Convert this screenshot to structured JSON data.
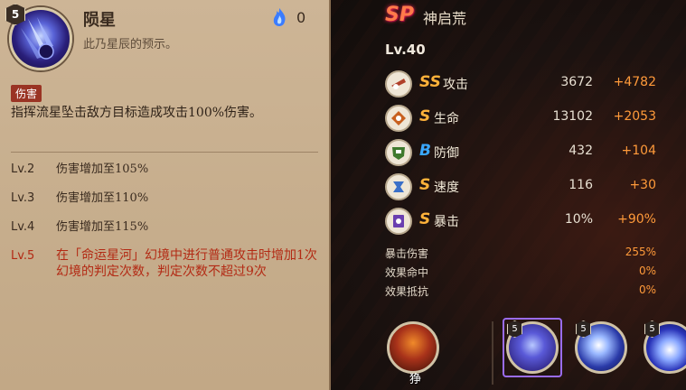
{
  "left": {
    "skill_level": "5",
    "skill_name": "陨星",
    "skill_desc": "此乃星辰的预示。",
    "orb_cost": "0",
    "tag": "伤害",
    "main_text": "指挥流星坠击敌方目标造成攻击100%伤害。",
    "levels": [
      {
        "lv": "Lv.2",
        "text": "伤害增加至105%"
      },
      {
        "lv": "Lv.3",
        "text": "伤害增加至110%"
      },
      {
        "lv": "Lv.4",
        "text": "伤害增加至115%"
      },
      {
        "lv": "Lv.5",
        "text": "在「命运星河」幻境中进行普通攻击时增加1次幻境的判定次数，判定次数不超过9次"
      }
    ]
  },
  "right": {
    "rarity": "SP",
    "name": "神启荒",
    "level": "Lv.40",
    "stats": [
      {
        "grade": "SS",
        "label": "攻击",
        "value": "3672",
        "bonus": "+4782",
        "grade_color": "#ffb23a",
        "icon": "attack-icon"
      },
      {
        "grade": "S",
        "label": "生命",
        "value": "13102",
        "bonus": "+2053",
        "grade_color": "#ffb23a",
        "icon": "hp-icon"
      },
      {
        "grade": "B",
        "label": "防御",
        "value": "432",
        "bonus": "+104",
        "grade_color": "#3aa8ff",
        "icon": "defense-icon"
      },
      {
        "grade": "S",
        "label": "速度",
        "value": "116",
        "bonus": "+30",
        "grade_color": "#ffb23a",
        "icon": "speed-icon"
      },
      {
        "grade": "S",
        "label": "暴击",
        "value": "10%",
        "bonus": "+90%",
        "grade_color": "#ffb23a",
        "icon": "crit-icon"
      }
    ],
    "sub_stats": [
      {
        "label": "暴击伤害",
        "value": "255%"
      },
      {
        "label": "效果命中",
        "value": "0%"
      },
      {
        "label": "效果抵抗",
        "value": "0%"
      }
    ],
    "skills": [
      {
        "badge": "",
        "label": "狰"
      },
      {
        "badge": "5",
        "label": ""
      },
      {
        "badge": "5",
        "label": ""
      },
      {
        "badge": "5",
        "label": ""
      }
    ]
  },
  "colors": {
    "accent_orange": "#ff9a3a",
    "highlight_red": "#b32a14",
    "tag_bg": "#9a3424"
  }
}
